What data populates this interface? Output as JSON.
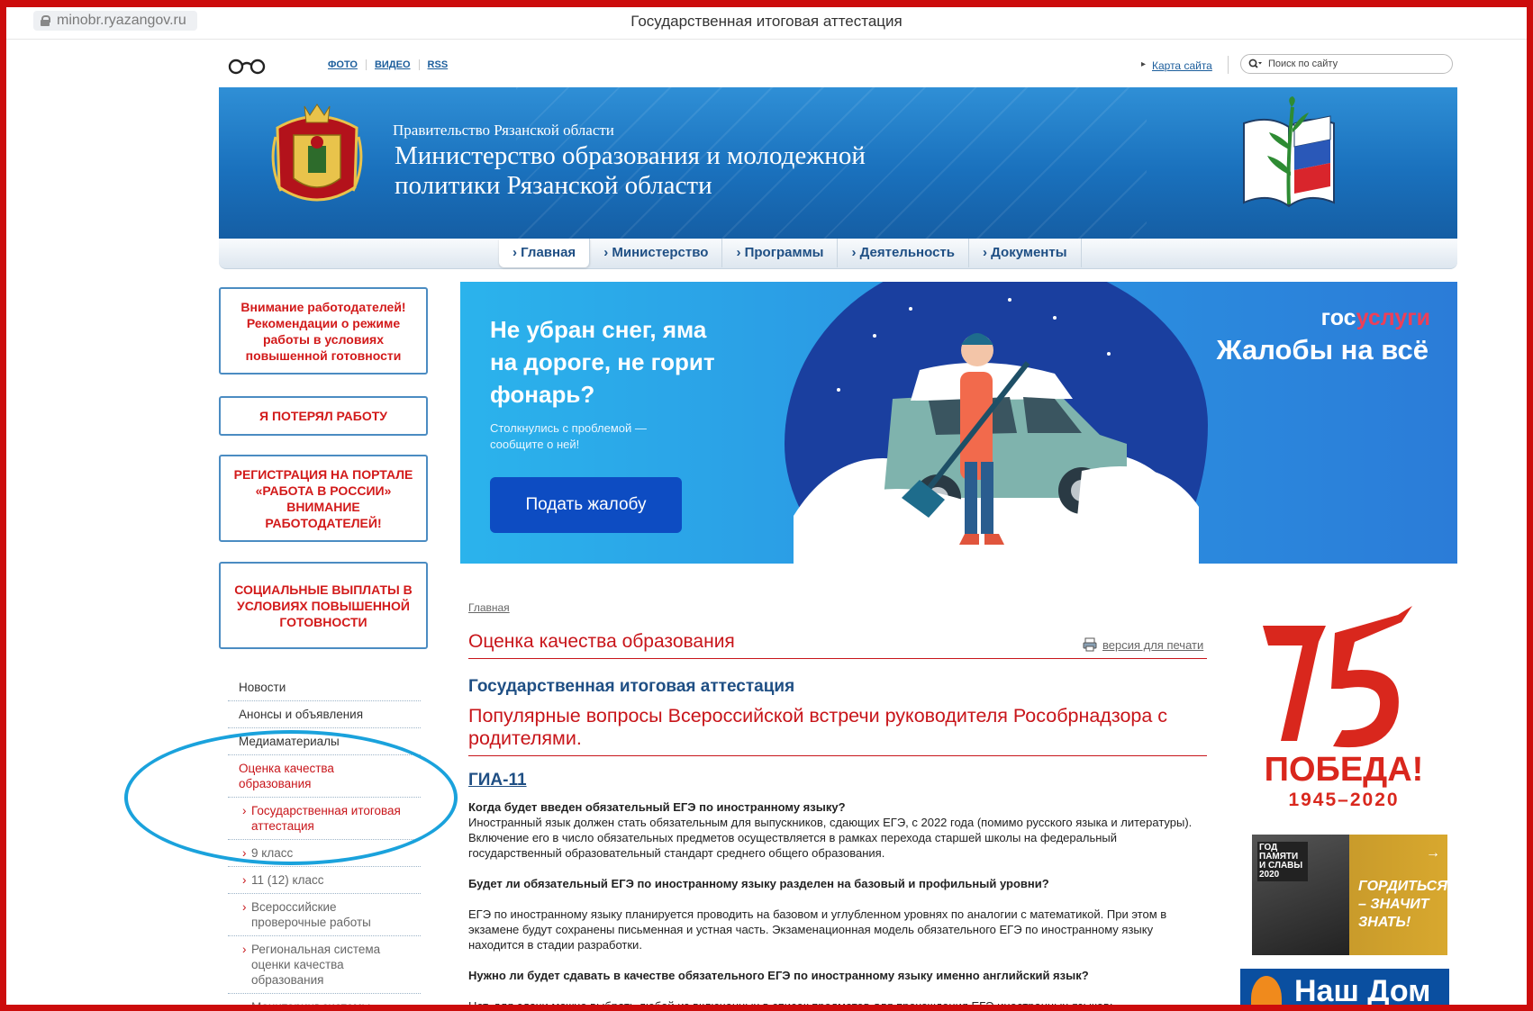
{
  "browser": {
    "url": "minobr.ryazangov.ru",
    "tab_title": "Государственная итоговая аттестация"
  },
  "util": {
    "links": [
      "ФОТО",
      "ВИДЕО",
      "RSS"
    ],
    "sitemap": "Карта сайта",
    "search_placeholder": "Поиск по сайту"
  },
  "header": {
    "gov": "Правительство Рязанской области",
    "ministry": "Министерство образования и молодежной политики Рязанской области"
  },
  "nav": {
    "items": [
      "Главная",
      "Министерство",
      "Программы",
      "Деятельность",
      "Документы"
    ],
    "active": "Главная"
  },
  "left_boxes": [
    "Внимание работодателей! Рекомендации о режиме работы в условиях повышенной готовности",
    "Я ПОТЕРЯЛ РАБОТУ",
    "РЕГИСТРАЦИЯ НА ПОРТАЛЕ «РАБОТА В РОССИИ» ВНИМАНИЕ РАБОТОДАТЕЛЕЙ!",
    "СОЦИАЛЬНЫЕ ВЫПЛАТЫ В УСЛОВИЯХ ПОВЫШЕННОЙ ГОТОВНОСТИ"
  ],
  "left_menu": [
    "Новости",
    "Анонсы и объявления",
    "Медиаматериалы",
    "Оценка качества образования",
    "Государственная итоговая аттестация",
    "9 класс",
    "11 (12) класс",
    "Всероссийские проверочные работы",
    "Региональная система оценки качества образования",
    "Мониторинг системы образования Рязанской"
  ],
  "promo": {
    "headline": "Не убран снег, яма на дороге, не горит фонарь?",
    "subtext": "Столкнулись с проблемой — сообщите о ней!",
    "button": "Подать жалобу",
    "brand_a": "гос",
    "brand_b": "услуги",
    "slogan": "Жалобы на всё"
  },
  "content": {
    "breadcrumb": "Главная",
    "title": "Оценка качества образования",
    "print": "версия для печати",
    "subtitle": "Государственная итоговая аттестация",
    "article_title": "Популярные вопросы Всероссийской встречи руководителя Рособрнадзора с родителями.",
    "section": "ГИА-11",
    "qa": [
      {
        "q": "Когда будет введен обязательный ЕГЭ по иностранному языку?",
        "a": "Иностранный язык должен стать обязательным для выпускников, сдающих ЕГЭ, с 2022 года (помимо русского языка и литературы). Включение его в число обязательных предметов осуществляется в рамках перехода старшей школы на федеральный государственный образовательный стандарт среднего общего образования."
      },
      {
        "q": "Будет ли обязательный ЕГЭ по иностранному языку разделен на базовый и профильный уровни?",
        "a": "ЕГЭ по иностранному языку планируется проводить на базовом и углубленном уровнях по аналогии с математикой. При этом в экзамене будут сохранены письменная и устная часть. Экзаменационная модель обязательного ЕГЭ по иностранному языку находится в стадии разработки."
      },
      {
        "q": "Нужно ли будет сдавать в качестве обязательного ЕГЭ по иностранному языку именно английский язык?",
        "a": "Нет, для сдачи можно выбрать любой из включенных в список предметов для прохождения ЕГЭ иностранных языков:"
      }
    ]
  },
  "right": {
    "pobeda_word": "ПОБЕДА!",
    "pobeda_years": "1945–2020",
    "pobeda_number": "75",
    "pamyat_tag": "ГОД ПАМЯТИ И СЛАВЫ 2020",
    "pamyat_text": "ГОРДИТЬСЯ – ЗНАЧИТ ЗНАТЬ!",
    "nashdom": "Наш Дом"
  },
  "colors": {
    "accent_red": "#c8151a",
    "link_blue": "#1f4f84",
    "header_blue": "#1a71bd",
    "highlight_ellipse": "#1aa2dc"
  }
}
